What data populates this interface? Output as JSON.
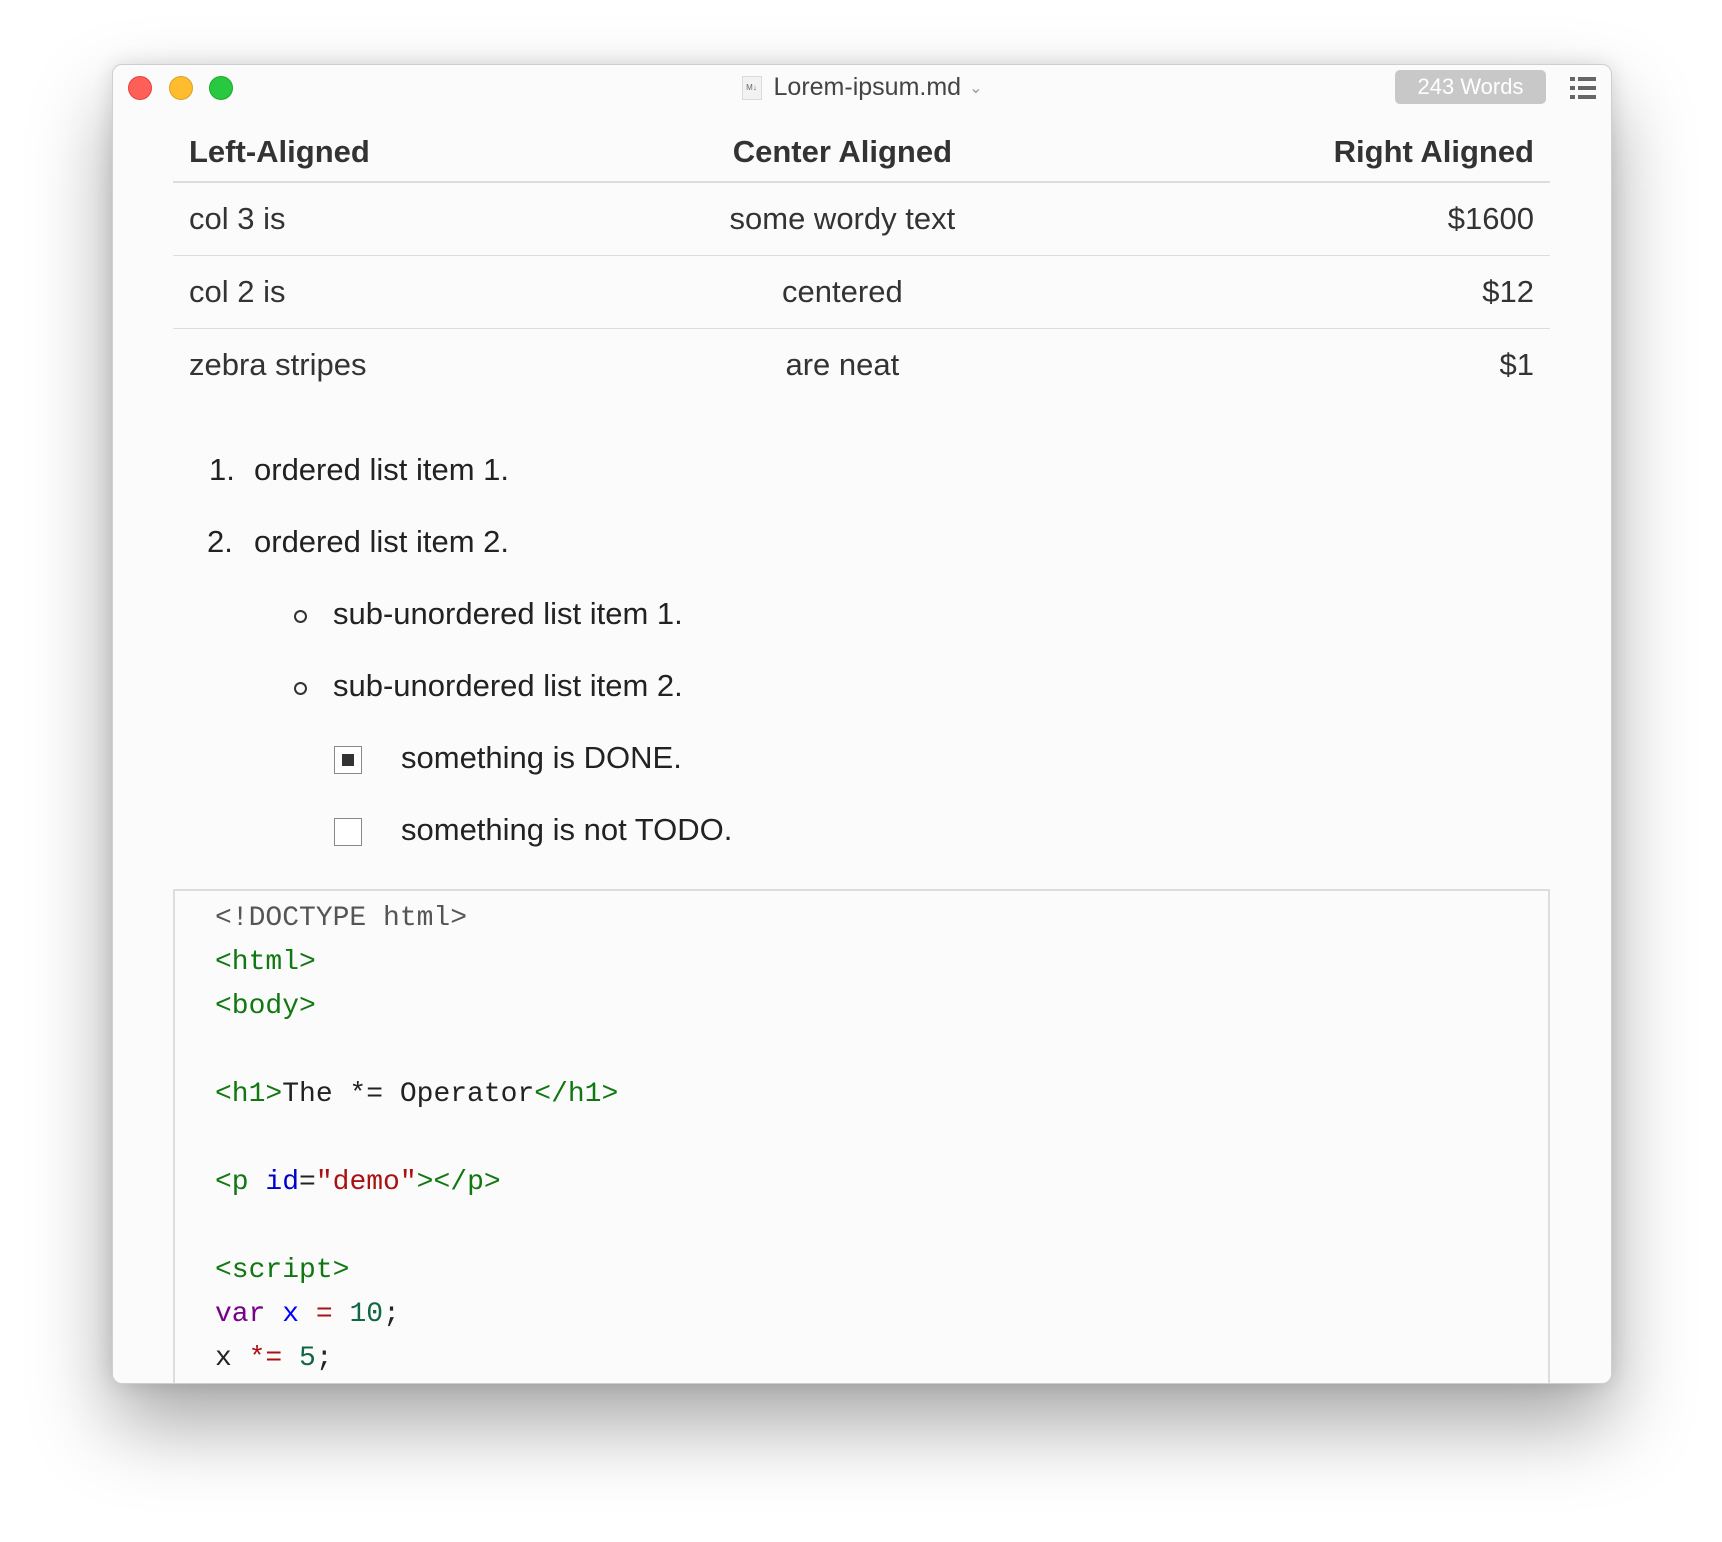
{
  "window": {
    "title": "Lorem-ipsum.md",
    "file_icon_label": "M↓",
    "word_count": "243 Words"
  },
  "table": {
    "headers": [
      "Left-Aligned",
      "Center Aligned",
      "Right Aligned"
    ],
    "rows": [
      [
        "col 3 is",
        "some wordy text",
        "$1600"
      ],
      [
        "col 2 is",
        "centered",
        "$12"
      ],
      [
        "zebra stripes",
        "are neat",
        "$1"
      ]
    ]
  },
  "ordered_list": [
    {
      "number": "1.",
      "text": "ordered list item 1."
    },
    {
      "number": "2.",
      "text": "ordered list item 2."
    }
  ],
  "sub_list": [
    "sub-unordered list item 1.",
    "sub-unordered list item 2."
  ],
  "tasks": [
    {
      "text": "something is DONE.",
      "checked": true
    },
    {
      "text": "something is not TODO.",
      "checked": false
    }
  ],
  "code": {
    "l1": "<!DOCTYPE html>",
    "l2": "<html>",
    "l3": "<body>",
    "l5a": "<h1>",
    "l5b": "The *= Operator",
    "l5c": "</h1>",
    "l7a": "<p ",
    "l7b": "id",
    "l7c": "=",
    "l7d": "\"demo\"",
    "l7e": "></p>",
    "l9": "<script>",
    "l10a": "var",
    "l10b": "x",
    "l10c": "=",
    "l10d": "10",
    "l10e": ";",
    "l11a": "x",
    "l11b": "*=",
    "l11c": "5",
    "l11d": ";"
  },
  "colors": {
    "tag": "#117711",
    "attribute": "#0000cc",
    "string": "#aa1111",
    "keyword": "#770088",
    "number": "#116644"
  }
}
